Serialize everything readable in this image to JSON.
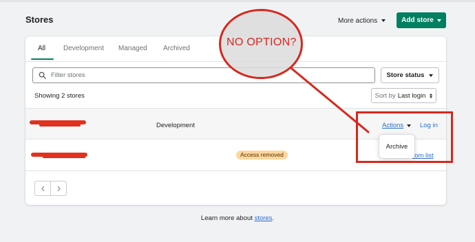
{
  "header": {
    "title": "Stores",
    "more_actions_label": "More actions",
    "add_store_label": "Add store"
  },
  "tabs": [
    {
      "label": "All",
      "active": true
    },
    {
      "label": "Development",
      "active": false
    },
    {
      "label": "Managed",
      "active": false
    },
    {
      "label": "Archived",
      "active": false
    }
  ],
  "filter": {
    "placeholder": "Filter stores",
    "value": "",
    "store_status_label": "Store status"
  },
  "list": {
    "showing_text": "Showing 2 stores",
    "sort_label": "Sort by",
    "sort_value": "Last login"
  },
  "rows": [
    {
      "name_redacted": true,
      "type": "Development",
      "actions_label": "Actions",
      "login_label": "Log in"
    },
    {
      "name_redacted": true,
      "badge": "Access removed",
      "link_label": "rom list"
    }
  ],
  "dropdown": {
    "items": [
      "Archive"
    ]
  },
  "footer": {
    "learn_prefix": "Learn more about ",
    "learn_link": "stores",
    "learn_suffix": "."
  },
  "annotation": {
    "text": "NO OPTION?",
    "color": "#d9261c"
  },
  "colors": {
    "primary": "#008060",
    "link": "#2c6ecb",
    "badge_bg": "#ffd79d"
  }
}
